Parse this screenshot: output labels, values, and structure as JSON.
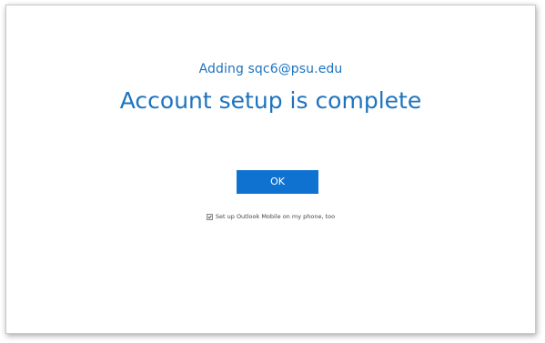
{
  "dialog": {
    "subtitle": "Adding sqc6@psu.edu",
    "title": "Account setup is complete",
    "ok_button_label": "OK",
    "mobile_checkbox": {
      "label": "Set up Outlook Mobile on my phone, too",
      "checked": true
    }
  },
  "colors": {
    "accent_text": "#1e73be",
    "button_bg": "#1072d0"
  }
}
